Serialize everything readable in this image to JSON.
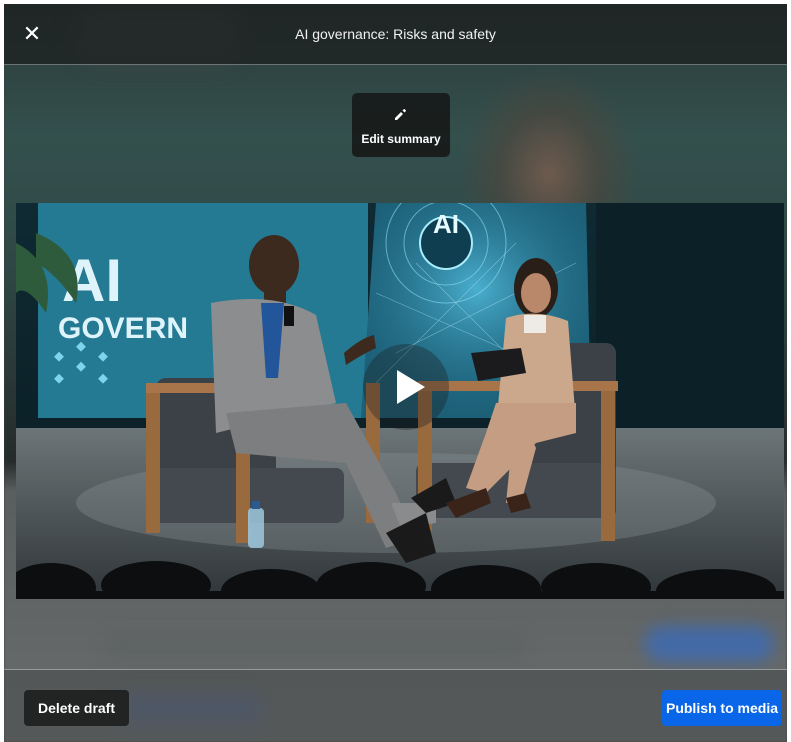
{
  "header": {
    "title": "AI governance: Risks and safety",
    "close_icon": "close-icon",
    "close_glyph": "✕"
  },
  "edit_summary": {
    "label": "Edit summary",
    "icon": "pencil-icon"
  },
  "video": {
    "backdrop_text_line1": "AI",
    "backdrop_text_line2": "GOVERN",
    "screen_badge": "AI",
    "play_icon": "play-icon"
  },
  "footer": {
    "delete_label": "Delete draft",
    "publish_label": "Publish to media"
  },
  "colors": {
    "publish_button": "#0a66e8",
    "delete_button": "#222424",
    "header_overlay": "#1c1e1e"
  }
}
